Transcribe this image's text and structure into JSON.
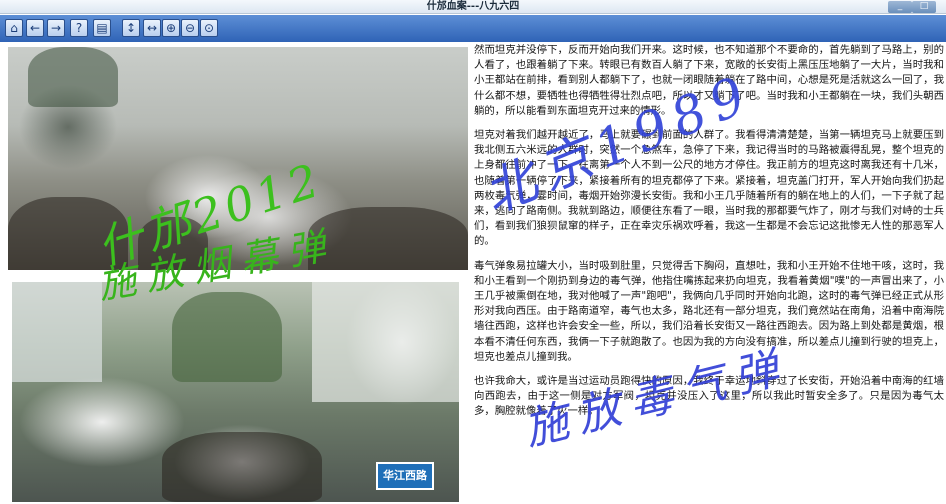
{
  "window": {
    "title": "什邡血案---八九六四",
    "minimize_icon": "minimize-icon",
    "maximize_icon": "maximize-icon"
  },
  "toolbar": {
    "buttons": [
      {
        "name": "home-button",
        "icon": "home-icon",
        "glyph": "⌂"
      },
      {
        "name": "back-button",
        "icon": "arrow-left-icon",
        "glyph": "←"
      },
      {
        "name": "forward-button",
        "icon": "arrow-right-icon",
        "glyph": "→"
      },
      {
        "name": "help-button",
        "icon": "help-icon",
        "glyph": "?"
      },
      {
        "name": "page-settings-button",
        "icon": "document-settings-icon",
        "glyph": "▤"
      },
      {
        "name": "fit-height-button",
        "icon": "fit-height-icon",
        "glyph": "↕"
      },
      {
        "name": "fit-width-button",
        "icon": "fit-width-icon",
        "glyph": "↔"
      },
      {
        "name": "zoom-in-button",
        "icon": "zoom-in-icon",
        "glyph": "⊕"
      },
      {
        "name": "zoom-out-button",
        "icon": "zoom-out-icon",
        "glyph": "⊖"
      },
      {
        "name": "zoom-reset-button",
        "icon": "zoom-reset-icon",
        "glyph": "⊙"
      }
    ]
  },
  "photos": {
    "bottom_street_sign": "华江西路"
  },
  "overlays": {
    "green_line1": "什邡2012",
    "green_line2": "施放烟幕弹",
    "blue_line1": "北京1989",
    "blue_line2": "施放毒气弹"
  },
  "article": {
    "paragraphs": [
      "然而坦克并没停下，反而开始向我们开来。这时候，也不知道那个不要命的，首先躺到了马路上，别的人看了，也跟着躺了下来。转眼已有数百人躺了下来，宽敞的长安街上黑压压地躺了一大片，当时我和小王都站在前排，看到别人都躺下了，也就一闭眼随着躺在了路中间，心想是死是活就这么一回了，我什么都不想，要牺牲也得牺牲得壮烈点吧，所以才又躺下了吧。当时我和小王都躺在一块，我们头朝西躺的，所以能看到东面坦克开过来的情形。",
      "坦克对着我们越开越近了，马上就要碾到前面的人群了。我看得清清楚楚，当第一辆坦克马上就要压到我北侧五六米远的人群时，突然一个急煞车，急停了下来，我记得当时的马路被震得乱晃，整个坦克的上身都往前冲了一下，在离第一个人不到一公尺的地方才停住。我正前方的坦克这时离我还有十几米，也随着第一辆停了下来，紧接着所有的坦克都停了下来。紧接着，坦克盖门打开，军人开始向我们扔起两枚毒气弹，霎时间，毒烟开始弥漫长安街。我和小王几乎随着所有的躺在地上的人们，一下子就了起来，逃向了路南侧。我就到路边，顺便往东看了一眼，当时我的那都要气炸了，刚才与我们对峙的士兵们，看到我们狼狈鼠窜的样子，正在幸灾乐祸欢呼着，我这一生都是不会忘记这批惨无人性的那恶军人的。",
      "毒气弹象易拉罐大小，当时吸到肚里，只觉得舌下胸闷，直想吐，我和小王开始不住地干咳，这时，我和小王看到一个刚扔到身边的毒气弹，他指住嘴拣起来扔向坦克，我看着黄烟\"噗\"的一声冒出来了，小王几乎被熏倒在地，我对他喊了一声\"跑吧\"，我俩向几乎同时开始向北跑，这时的毒气弹已经正式从形形对我向西压。由于路南道窄，毒气也太多，路北还有一部分坦克，我们竟然站在南角，沿着中南海院墙往西跑，这样也许会安全一些，所以，我们沿着长安街又一路往西跑去。因为路上到处都是黄烟，根本看不清任何东西，我俩一下子就跑散了。也因为我的方向没有搞准，所以差点儿撞到行驶的坦克上，坦克也差点儿撞到我。",
      "也许我命大，或许是当过运动员跑得快的原因，我终于幸运地斜穿过了长安街，开始沿着中南海的红墙向西跑去，由于这一侧是对方军阀，坦克并没压入了这里，所以我此时暂安全多了。只是因为毒气太多，胸腔就像着了火一样。"
    ]
  }
}
